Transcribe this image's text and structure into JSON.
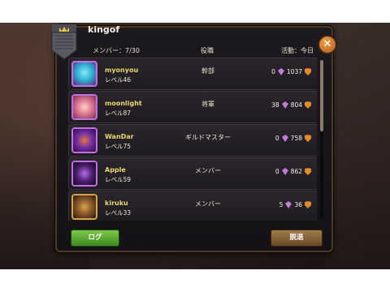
{
  "guild": {
    "name": "kingof"
  },
  "header": {
    "members": "メンバー：7/30",
    "role": "役職",
    "activity": "活動：今日"
  },
  "members": [
    {
      "name": "myonyou",
      "level": "レベル46",
      "role": "幹部",
      "stat_a": "0",
      "stat_b": "1037",
      "avatar": "blue-spirit-avatar",
      "avatar_color": "#2fb3d6"
    },
    {
      "name": "moonlight",
      "level": "レベル87",
      "role": "将軍",
      "stat_a": "38",
      "stat_b": "804",
      "avatar": "pink-hair-girl-avatar",
      "avatar_color": "#e07a9a"
    },
    {
      "name": "WanDar",
      "level": "レベル75",
      "role": "ギルドマスター",
      "stat_a": "0",
      "stat_b": "758",
      "avatar": "purple-beast-avatar",
      "avatar_color": "#7a2fa8"
    },
    {
      "name": "Apple",
      "level": "レベル59",
      "role": "メンバー",
      "stat_a": "0",
      "stat_b": "862",
      "avatar": "dark-portal-avatar",
      "avatar_color": "#4a1f6a"
    },
    {
      "name": "kiruku",
      "level": "レベル33",
      "role": "メンバー",
      "stat_a": "5",
      "stat_b": "36",
      "avatar": "bronze-golem-avatar",
      "avatar_color": "#8a5a2a"
    }
  ],
  "buttons": {
    "log": "ログ",
    "leave": "脱退",
    "close": "✕"
  },
  "icons": {
    "gem": "gem-icon",
    "shield": "shield-icon",
    "close": "close-icon",
    "emblem": "guild-emblem-icon"
  },
  "colors": {
    "name_text": "#e9d76e",
    "avatar_border": "#c06fe8",
    "log_button": "#5fae34",
    "leave_button": "#8a643a",
    "close_button": "#d9802f"
  }
}
